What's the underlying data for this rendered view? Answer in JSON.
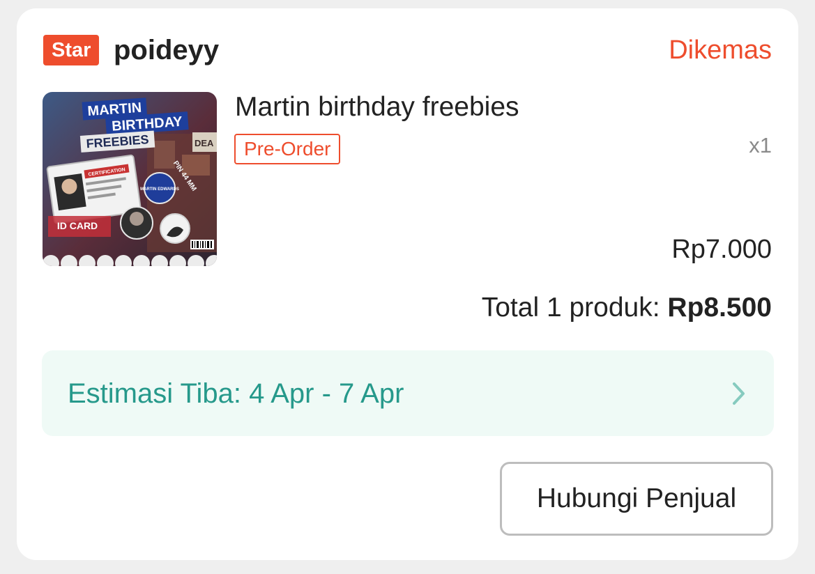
{
  "shop": {
    "badge": "Star",
    "name": "poideyy",
    "badge_color": "#ee4d2d"
  },
  "order": {
    "status": "Dikemas",
    "product": {
      "title": "Martin birthday freebies",
      "tag": "Pre-Order",
      "quantity": "x1",
      "price": "Rp7.000",
      "thumbnail_text": {
        "line1": "MARTIN",
        "line2": "BIRTHDAY",
        "line3": "FREEBIES",
        "card_label": "ID CARD",
        "pin_label": "PIN 44 MM",
        "certification": "CERTIFICATION",
        "button_text": "MARTIN EDWARDS",
        "sign": "DEA"
      }
    },
    "total_label": "Total 1 produk:",
    "total_amount": "Rp8.500"
  },
  "delivery": {
    "estimate": "Estimasi Tiba: 4 Apr - 7 Apr",
    "chevron_icon": "chevron-right-icon",
    "accent": "#26998b"
  },
  "actions": {
    "contact_seller": "Hubungi Penjual"
  }
}
